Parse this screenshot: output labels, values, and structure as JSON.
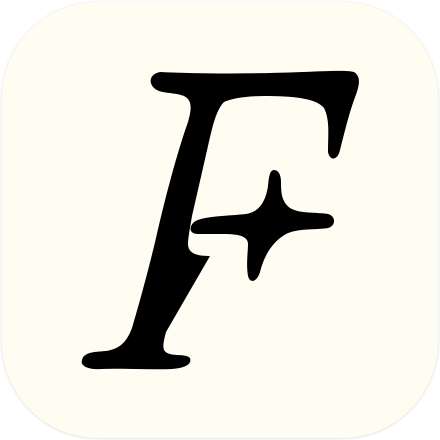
{
  "app_icon": {
    "letter": "F",
    "background_color": "#fffdf2",
    "glyph_color": "#000000",
    "icon": "serif-italic-f-icon"
  }
}
